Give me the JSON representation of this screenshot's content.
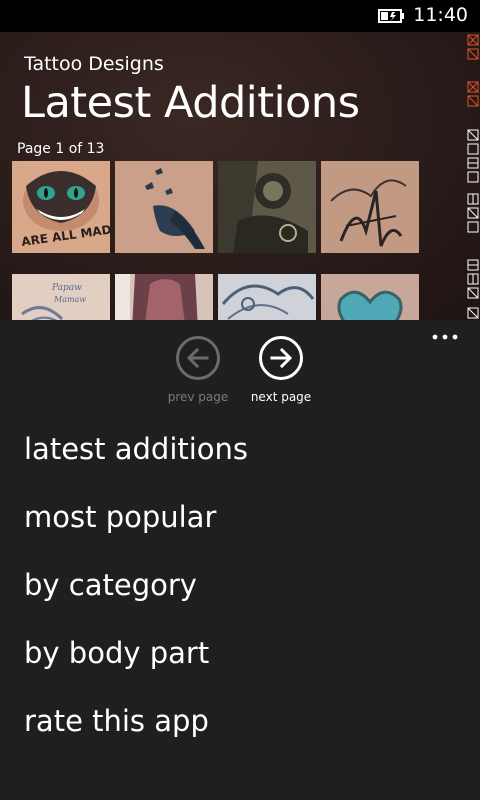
{
  "status": {
    "time": "11:40"
  },
  "header": {
    "app_title": "Tattoo Designs",
    "page_title": "Latest Additions",
    "page_indicator": "Page 1 of 13"
  },
  "thumbnails": [
    {
      "name": "cheshire-cat-tattoo",
      "caption": "ARE ALL MAD"
    },
    {
      "name": "birds-tattoo"
    },
    {
      "name": "sleeve-tattoo"
    },
    {
      "name": "signature-tattoo"
    },
    {
      "name": "praying-hands-tattoo"
    },
    {
      "name": "portrait-tattoo"
    },
    {
      "name": "ornamental-tattoo"
    },
    {
      "name": "blue-heart-tattoo"
    }
  ],
  "app_bar": {
    "prev_label": "prev page",
    "next_label": "next page",
    "more_icon": "ellipsis-icon",
    "prev_icon": "arrow-left-icon",
    "next_icon": "arrow-right-icon"
  },
  "menu": [
    {
      "label": "latest additions"
    },
    {
      "label": "most popular"
    },
    {
      "label": "by category"
    },
    {
      "label": "by body part"
    },
    {
      "label": "rate this app"
    }
  ],
  "colors": {
    "app_bar_bg": "#1f1f1f",
    "header_bg": "#2a1c1a",
    "disabled": "#6b6b6b",
    "jump_accent": "#e0522c"
  }
}
